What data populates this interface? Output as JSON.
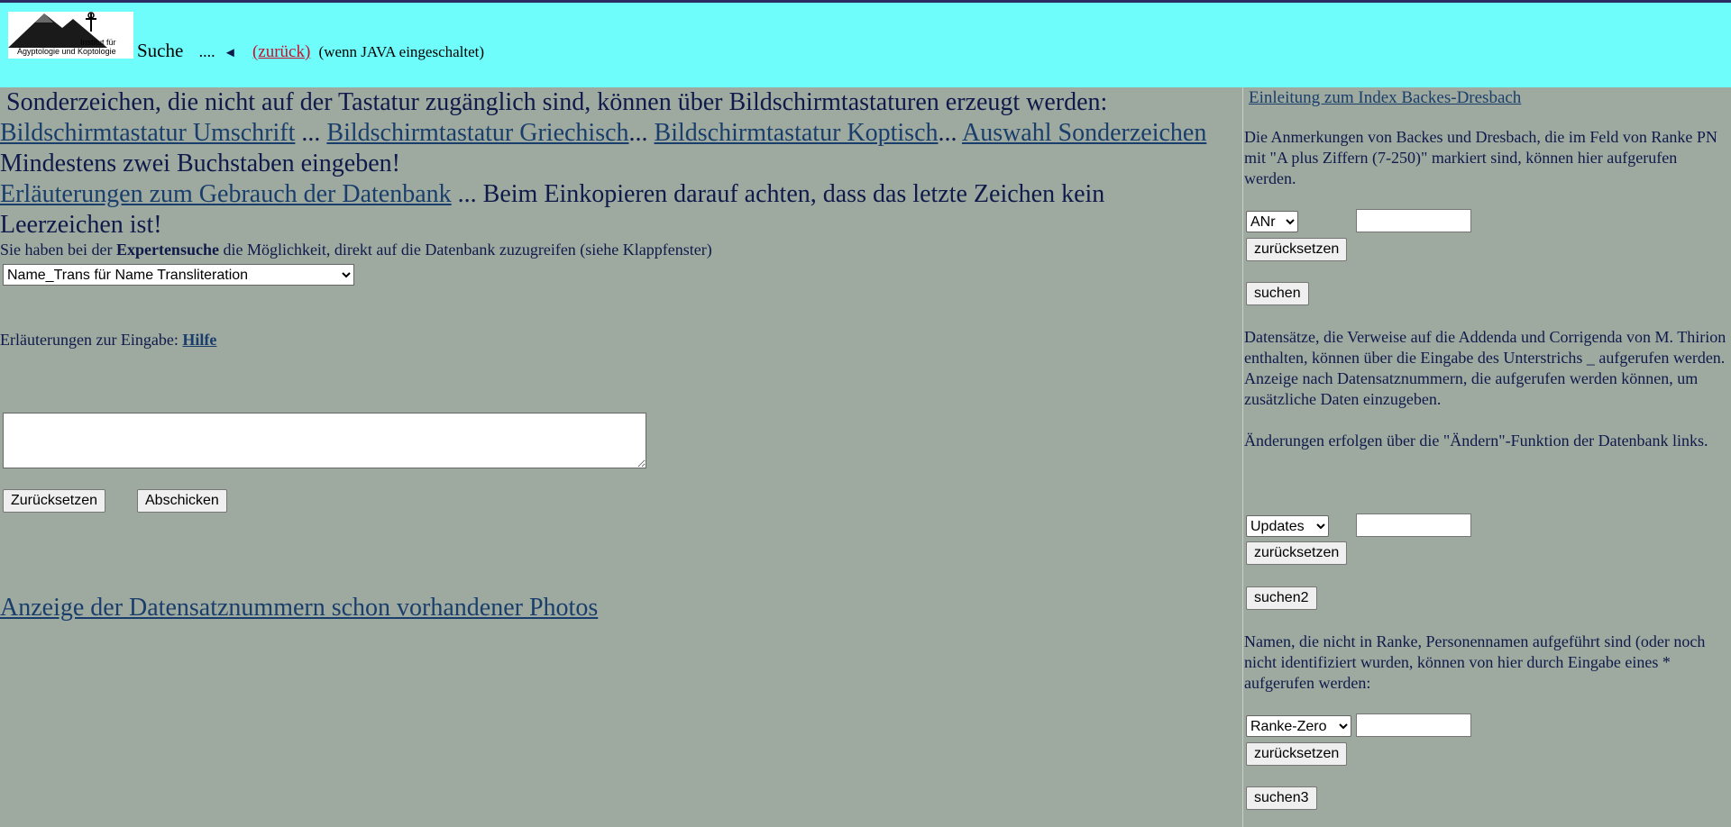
{
  "header": {
    "logo_text_line1": "Institut für",
    "logo_text_line2": "Ägyptologie und Koptologie",
    "title": "Suche",
    "dots": "....",
    "back_arrow": "◄",
    "back_link": "(zurück)",
    "java_note": "(wenn JAVA eingeschaltet)"
  },
  "main": {
    "intro_text": "Sonderzeichen, die nicht auf der Tastatur zugänglich sind, können über Bildschirmtastaturen erzeugt werden:",
    "link_umschrift": "Bildschirmtastatur Umschrift",
    "sep1": " ... ",
    "link_griechisch": "Bildschirmtastatur Griechisch",
    "sep2": "... ",
    "link_koptisch": "Bildschirmtastatur Koptisch",
    "sep3": "... ",
    "link_sonderzeichen": "Auswahl Sonderzeichen",
    "min_chars": " Mindestens zwei Buchstaben eingeben!",
    "link_erlaeuterungen": "Erläuterungen zum Gebrauch der Datenbank",
    "copy_note": " ... Beim Einkopieren darauf achten, dass das letzte Zeichen kein Leerzeichen ist!",
    "expert_pre": "Sie haben bei der ",
    "expert_bold": "Expertensuche",
    "expert_post": " die Möglichkeit, direkt auf die Datenbank zuzugreifen (siehe Klappfenster)",
    "field_select_value": "Name_Trans für Name Transliteration",
    "help_label": "Erläuterungen zur Eingabe: ",
    "help_link": "Hilfe",
    "query_value": "",
    "reset_label": "Zurücksetzen",
    "submit_label": "Abschicken",
    "photos_link": "Anzeige der Datensatznummern schon vorhandener Photos"
  },
  "sidebar": {
    "intro_link": "Einleitung zum Index Backes-Dresbach",
    "text1": "Die Anmerkungen von Backes und Dresbach, die im Feld von Ranke PN mit \"A plus Ziffern (7-250)\" markiert sind, können hier aufgerufen werden.",
    "select1_value": "ANr",
    "input1_value": "",
    "reset1_label": "zurücksetzen",
    "search1_label": "suchen",
    "text2": "Datensätze, die Verweise auf die Addenda und Corrigenda von M. Thirion enthalten, können über die Eingabe des Unterstrichs _ aufgerufen werden. Anzeige nach Datensatznummern, die aufgerufen werden können, um zusätzliche Daten einzugeben.",
    "text2b": "Änderungen erfolgen über die \"Ändern\"-Funktion der Datenbank links.",
    "select2_value": "Updates",
    "input2_value": "",
    "reset2_label": "zurücksetzen",
    "search2_label": "suchen2",
    "text3": "Namen, die nicht in Ranke, Personennamen aufgeführt sind (oder noch nicht identifiziert wurden, können von hier durch Eingabe eines * aufgerufen werden:",
    "select3_value": "Ranke-Zero",
    "input3_value": "",
    "reset3_label": "zurücksetzen",
    "search3_label": "suchen3"
  },
  "colors": {
    "header_bg": "#6ffdfb",
    "page_bg": "#9eaaa0",
    "link": "#1a3e6b",
    "back_link": "#c8102e"
  },
  "icons": [
    "institute-logo",
    "back-arrow-icon",
    "chevron-down-icon"
  ]
}
